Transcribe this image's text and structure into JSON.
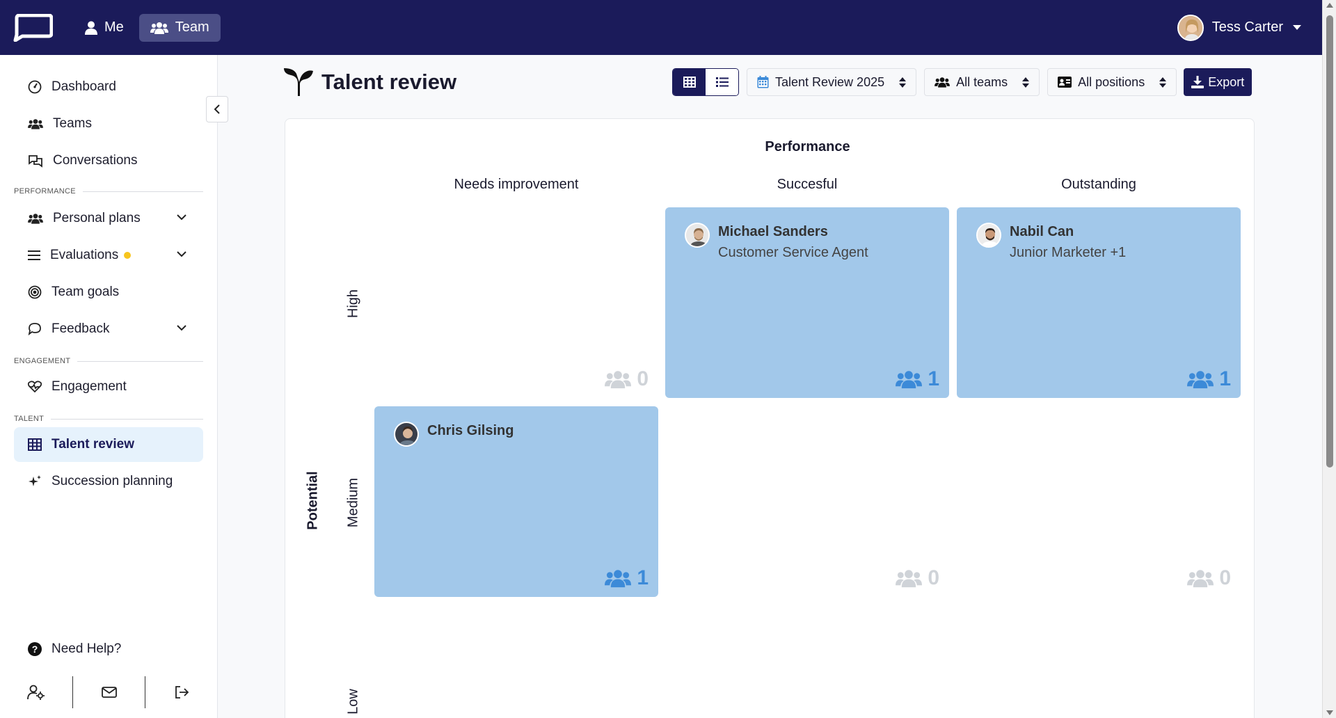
{
  "topbar": {
    "nav": [
      {
        "label": "Me",
        "icon": "user-icon",
        "active": false
      },
      {
        "label": "Team",
        "icon": "users-icon",
        "active": true
      }
    ],
    "user_name": "Tess Carter"
  },
  "sidebar": {
    "items": {
      "dashboard": "Dashboard",
      "teams": "Teams",
      "conversations": "Conversations",
      "personal_plans": "Personal plans",
      "evaluations": "Evaluations",
      "team_goals": "Team goals",
      "feedback": "Feedback",
      "engagement": "Engagement",
      "talent_review": "Talent review",
      "succession_planning": "Succession planning",
      "need_help": "Need Help?"
    },
    "sections": {
      "performance": "PERFORMANCE",
      "engagement": "ENGAGEMENT",
      "talent": "TALENT"
    },
    "active": "talent_review",
    "notification_dot_color": "#f7c51e"
  },
  "header": {
    "title": "Talent review",
    "filters": {
      "cycle": "Talent Review 2025",
      "teams": "All teams",
      "positions": "All positions"
    },
    "export_label": "Export"
  },
  "grid": {
    "axis_title_x": "Performance",
    "axis_title_y": "Potential",
    "columns": [
      "Needs improvement",
      "Succesful",
      "Outstanding"
    ],
    "rows": [
      "High",
      "Medium",
      "Low"
    ],
    "cells": {
      "high_needs": {
        "count": "0",
        "people": []
      },
      "high_succ": {
        "count": "1",
        "people": [
          {
            "name": "Michael Sanders",
            "role": "Customer Service Agent"
          }
        ]
      },
      "high_out": {
        "count": "1",
        "people": [
          {
            "name": "Nabil Can",
            "role": "Junior Marketer +1"
          }
        ]
      },
      "med_needs": {
        "count": "1",
        "people": [
          {
            "name": "Chris Gilsing",
            "role": ""
          }
        ]
      },
      "med_succ": {
        "count": "0",
        "people": []
      },
      "med_out": {
        "count": "0",
        "people": []
      }
    }
  },
  "colors": {
    "brand": "#1b1b5a",
    "cell_filled": "#a2c8ea",
    "count_active": "#3c8ad8",
    "count_empty": "#cfd3d8",
    "active_nav_bg": "#e6f2fc"
  }
}
